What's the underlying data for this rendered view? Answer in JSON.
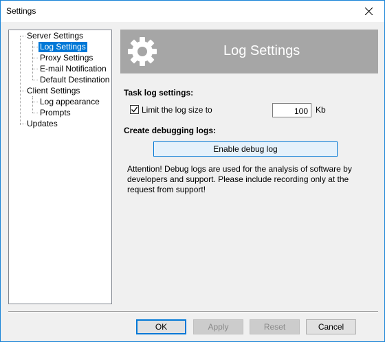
{
  "window": {
    "title": "Settings",
    "close_icon": "close-icon"
  },
  "tree": {
    "items": [
      {
        "label": "Server Settings"
      },
      {
        "label": "Log Settings"
      },
      {
        "label": "Proxy Settings"
      },
      {
        "label": "E-mail Notification"
      },
      {
        "label": "Default Destination"
      },
      {
        "label": "Client Settings"
      },
      {
        "label": "Log appearance"
      },
      {
        "label": "Prompts"
      },
      {
        "label": "Updates"
      }
    ],
    "selected": "Log Settings"
  },
  "banner": {
    "title": "Log Settings",
    "icon": "gear-icon"
  },
  "task_log": {
    "heading": "Task log settings:",
    "limit_label": "Limit the log size to",
    "limit_checked": true,
    "limit_value": "100",
    "unit": "Kb"
  },
  "debug": {
    "heading": "Create debugging logs:",
    "button_label": "Enable debug log",
    "attention": "Attention! Debug logs are used for the analysis of software by developers and support. Please include recording only at the request from support!"
  },
  "footer": {
    "ok": "OK",
    "apply": "Apply",
    "reset": "Reset",
    "cancel": "Cancel"
  },
  "colors": {
    "accent": "#0078d7",
    "banner": "#a6a6a6"
  }
}
